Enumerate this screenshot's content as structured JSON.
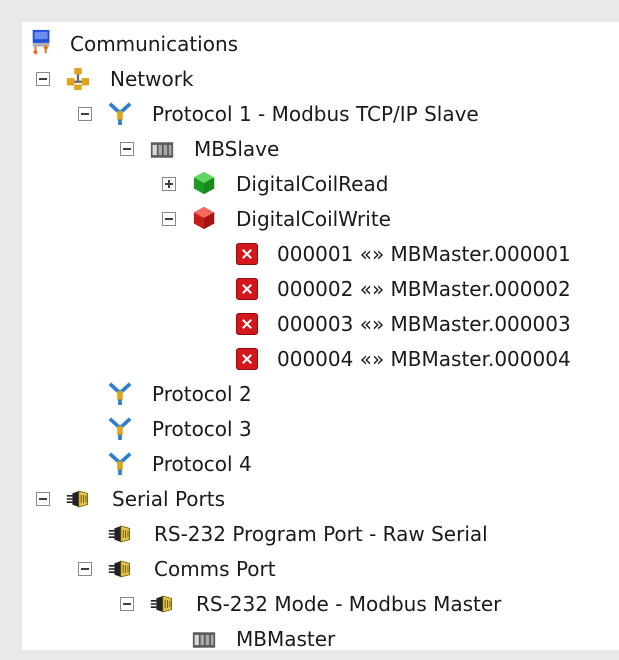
{
  "tree": {
    "communications": {
      "label": "Communications",
      "icon": "communications-icon"
    },
    "network": {
      "label": "Network",
      "icon": "network-icon"
    },
    "protocol1": {
      "label": "Protocol 1 - Modbus TCP/IP Slave",
      "icon": "protocol-icon"
    },
    "mbslave": {
      "label": "MBSlave",
      "icon": "device-icon"
    },
    "digital_coil_read": {
      "label": "DigitalCoilRead",
      "icon": "green-cube-icon"
    },
    "digital_coil_write": {
      "label": "DigitalCoilWrite",
      "icon": "red-cube-icon"
    },
    "mappings": [
      {
        "label": "000001 «» MBMaster.000001",
        "icon": "error-x-icon"
      },
      {
        "label": "000002 «» MBMaster.000002",
        "icon": "error-x-icon"
      },
      {
        "label": "000003 «» MBMaster.000003",
        "icon": "error-x-icon"
      },
      {
        "label": "000004 «» MBMaster.000004",
        "icon": "error-x-icon"
      }
    ],
    "protocol2": {
      "label": "Protocol 2",
      "icon": "protocol-icon"
    },
    "protocol3": {
      "label": "Protocol 3",
      "icon": "protocol-icon"
    },
    "protocol4": {
      "label": "Protocol 4",
      "icon": "protocol-icon"
    },
    "serial_ports": {
      "label": "Serial Ports",
      "icon": "serial-port-icon"
    },
    "rs232_program": {
      "label": "RS-232 Program Port - Raw Serial",
      "icon": "serial-port-icon"
    },
    "comms_port": {
      "label": "Comms Port",
      "icon": "serial-port-icon"
    },
    "rs232_mode": {
      "label": "RS-232 Mode - Modbus Master",
      "icon": "serial-port-icon"
    },
    "mbmaster": {
      "label": "MBMaster",
      "icon": "device-icon"
    }
  },
  "colors": {
    "protocol_blue": "#2f7fd0",
    "protocol_gold": "#e0a31a",
    "error_red": "#d4171c",
    "green_cube": "#27b52b",
    "red_cube": "#d9231f"
  }
}
